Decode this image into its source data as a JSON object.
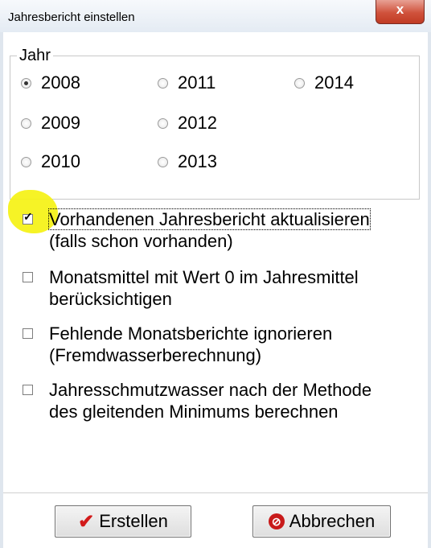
{
  "window": {
    "title": "Jahresbericht einstellen",
    "close_glyph": "x"
  },
  "year_group": {
    "legend": "Jahr",
    "options": [
      {
        "label": "2008",
        "selected": true
      },
      {
        "label": "2011",
        "selected": false
      },
      {
        "label": "2014",
        "selected": false
      },
      {
        "label": "2009",
        "selected": false
      },
      {
        "label": "2012",
        "selected": false
      },
      {
        "label": "2010",
        "selected": false
      },
      {
        "label": "2013",
        "selected": false
      }
    ]
  },
  "options": [
    {
      "line1": "Vorhandenen Jahresbericht aktualisieren",
      "line2": "(falls schon vorhanden)",
      "checked": true
    },
    {
      "line1": "Monatsmittel mit Wert 0 im Jahresmittel",
      "line2": "berücksichtigen",
      "checked": false
    },
    {
      "line1": "Fehlende Monatsberichte ignorieren",
      "line2": "(Fremdwasserberechnung)",
      "checked": false
    },
    {
      "line1": "Jahresschmutzwasser nach der Methode",
      "line2": "des gleitenden Minimums berechnen",
      "checked": false
    }
  ],
  "buttons": {
    "create_label": "Erstellen",
    "create_icon": "red-checkmark-icon",
    "cancel_label": "Abbrechen",
    "cancel_icon": "stop-icon"
  },
  "colors": {
    "highlight": "#f6f21a",
    "close_button": "#c9452f"
  }
}
